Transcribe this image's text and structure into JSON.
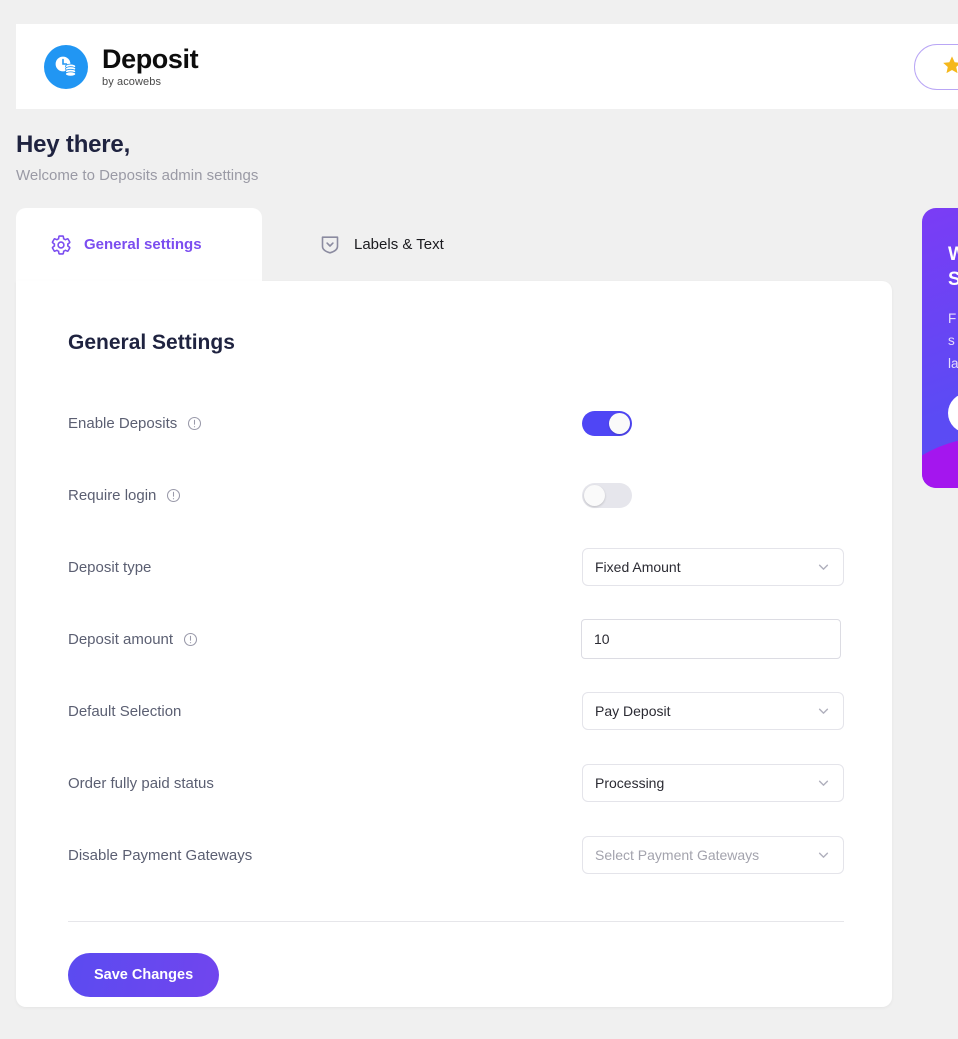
{
  "header": {
    "brand_title": "Deposit",
    "brand_subtitle": "by acowebs",
    "logo_icon": "clock-coins-icon",
    "logo_color": "#2196f3",
    "star_button_icon": "star-icon",
    "star_button_label": "",
    "star_color": "#f5b81c",
    "star_border_color": "#b9a6f5"
  },
  "greeting": {
    "title": "Hey there,",
    "subtitle": "Welcome to Deposits admin settings"
  },
  "tabs": [
    {
      "label": "General settings",
      "icon": "gear-icon",
      "active": true
    },
    {
      "label": "Labels & Text",
      "icon": "shield-chevron-down-icon",
      "active": false
    }
  ],
  "main": {
    "title": "General Settings",
    "accent_color": "#7b4df0",
    "toggle_on_color": "#4f46f5",
    "toggle_off_color": "#e6e6ec",
    "fields": [
      {
        "label": "Enable Deposits",
        "has_info_icon": true,
        "info_icon": "info-circle-icon",
        "control": "toggle",
        "value": "on"
      },
      {
        "label": "Require login",
        "has_info_icon": true,
        "info_icon": "info-circle-icon",
        "control": "toggle",
        "value": "off"
      },
      {
        "label": "Deposit type",
        "has_info_icon": false,
        "control": "select",
        "value": "Fixed Amount",
        "is_placeholder": false
      },
      {
        "label": "Deposit amount",
        "has_info_icon": true,
        "info_icon": "info-circle-icon",
        "control": "input",
        "value": "10",
        "placeholder": ""
      },
      {
        "label": "Default Selection",
        "has_info_icon": false,
        "control": "select",
        "value": "Pay Deposit",
        "is_placeholder": false
      },
      {
        "label": "Order fully paid status",
        "has_info_icon": false,
        "control": "select",
        "value": "Processing",
        "is_placeholder": false
      },
      {
        "label": "Disable Payment Gateways",
        "has_info_icon": false,
        "control": "select",
        "value": "Select Payment Gateways",
        "is_placeholder": true
      }
    ],
    "save_label": "Save Changes"
  },
  "promo": {
    "title_line1": "W",
    "title_line2": "S",
    "body_line1": "F",
    "body_line2": "s",
    "body_line3": "la",
    "button_label": "",
    "gradient_start": "#7b3cf5",
    "gradient_end": "#5a4df3",
    "blob_color": "#a416ee"
  }
}
